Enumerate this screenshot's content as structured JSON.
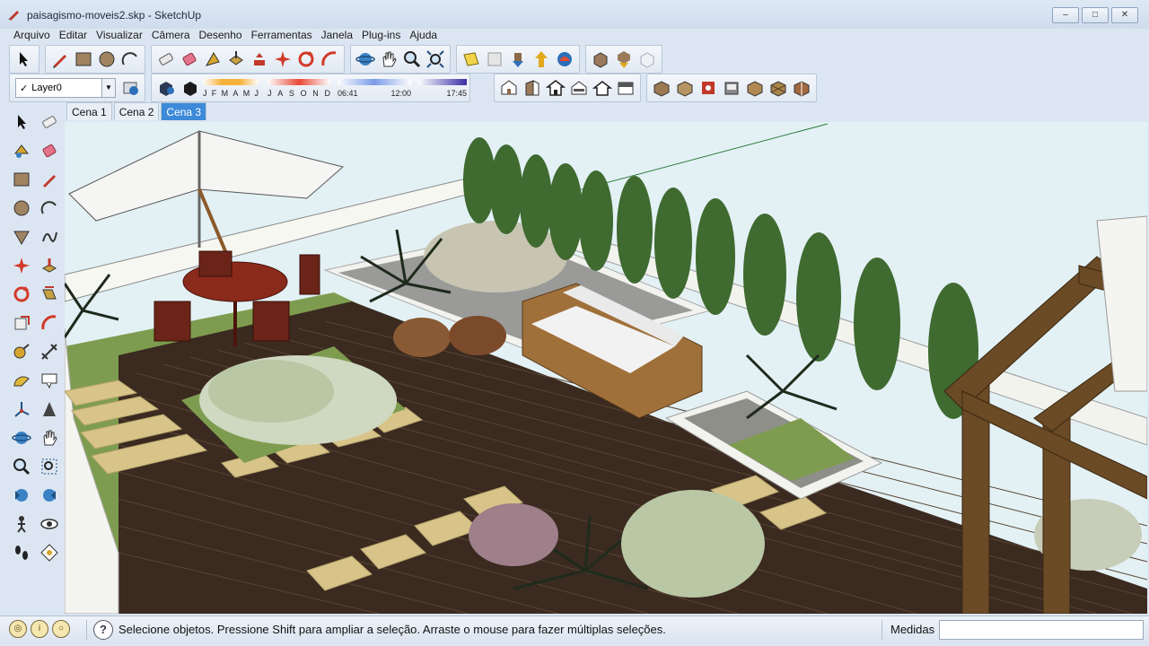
{
  "window": {
    "title": "paisagismo-moveis2.skp - SketchUp",
    "minimize": "–",
    "maximize": "□",
    "close": "✕"
  },
  "menu": [
    "Arquivo",
    "Editar",
    "Visualizar",
    "Câmera",
    "Desenho",
    "Ferramentas",
    "Janela",
    "Plug-ins",
    "Ajuda"
  ],
  "layer": {
    "name": "Layer0",
    "checked": "✓"
  },
  "shadow": {
    "months": [
      "J",
      "F",
      "M",
      "A",
      "M",
      "J",
      "J",
      "A",
      "S",
      "O",
      "N",
      "D"
    ],
    "time_start": "06:41",
    "time_mid": "12:00",
    "time_end": "17:45"
  },
  "scenes": [
    {
      "label": "Cena 1",
      "active": false
    },
    {
      "label": "Cena 2",
      "active": false
    },
    {
      "label": "Cena 3",
      "active": true
    }
  ],
  "status": {
    "help": "?",
    "message": "Selecione objetos. Pressione Shift para ampliar a seleção. Arraste o mouse para fazer múltiplas seleções.",
    "measure_label": "Medidas",
    "measure_value": ""
  },
  "colors": {
    "sky": "#e3f1f5",
    "deck": "#3a2a20",
    "grass": "#7e9c4f",
    "stone": "#d8c489",
    "cypress": "#3f6a30",
    "sofa": "#a0703a",
    "cushion": "#f2f2f2",
    "timber": "#6b4a26",
    "scene_active": "#3d8ad9"
  },
  "icons": {
    "top_row1": [
      "select-icon",
      "pencil-icon",
      "rectangle-icon",
      "circle-icon",
      "arc-icon",
      "eraser-icon",
      "paint-bucket-icon",
      "offset-icon",
      "push-pull-icon",
      "move-icon",
      "rotate-icon",
      "follow-me-icon",
      "orbit-icon",
      "pan-icon",
      "zoom-icon",
      "zoom-extents-icon",
      "get-models-icon",
      "share-model-icon",
      "components-icon",
      "styles-icon",
      "google-earth-icon",
      "photo-texture-icon",
      "upload-icon",
      "preview-icon"
    ],
    "top_row2_right": [
      "iso-view-icon",
      "top-view-icon",
      "front-view-icon",
      "right-view-icon",
      "back-view-icon",
      "left-view-icon",
      "xray-icon",
      "wireframe-icon",
      "hidden-line-icon",
      "shaded-icon",
      "textured-icon",
      "monochrome-icon"
    ]
  }
}
